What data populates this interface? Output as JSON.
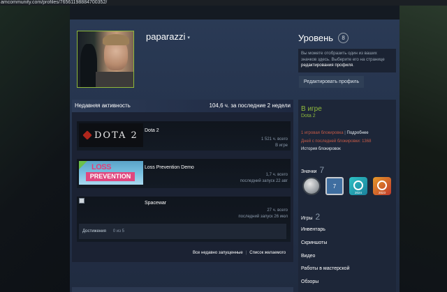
{
  "browser": {
    "url": "amcommunity.com/profiles/76561198884700352/"
  },
  "profile": {
    "persona_name": "paparazzi",
    "caret": "▾"
  },
  "level": {
    "title": "Уровень",
    "value": "8",
    "info_text_1": "Вы можете отобразить один из ваших значков здесь. Выберите его на странице ",
    "info_text_link": "редактирования профиля",
    "info_text_2": ".",
    "edit_button": "Редактировать профиль"
  },
  "activity": {
    "title": "Недавняя активность",
    "hours_summary": "104,6 ч. за последние 2 недели",
    "games": [
      {
        "name": "Dota 2",
        "capsule_text": "DOTA 2",
        "stat1": "1 521 ч. всего",
        "stat2": "В игре"
      },
      {
        "name": "Loss Prevention Demo",
        "capsule_line1": "LOSS",
        "capsule_line2": "PREVENTION",
        "stat1": "1,7 ч. всего",
        "stat2": "последний запуск 22 авг"
      },
      {
        "name": "Spacewar",
        "stat1": "27 ч. всего",
        "stat2": "последний запуск 26 июл",
        "achievements_label": "Достижения",
        "achievements_value": "0 из 5"
      }
    ],
    "link_recent": "Все недавно запущенные",
    "link_separator": "|",
    "link_wishlist": "Список желаемого"
  },
  "sidebar": {
    "status_title": "В игре",
    "status_game": "Dota 2",
    "ban_text": "1 игровая блокировка",
    "ban_separator": "|",
    "ban_more": "Подробнее",
    "ban_days": "Дней с последней блокировки: 1368",
    "ban_history": "История блокировок",
    "badges_label": "Значки",
    "badges_count": "7",
    "badge_items": [
      {
        "name": "silver-coin-badge-icon"
      },
      {
        "name": "years-of-service-badge-icon",
        "text": "7"
      },
      {
        "name": "steam-2024-badge-icon",
        "year": "2024"
      },
      {
        "name": "steam-2023-badge-icon",
        "year": "2023"
      }
    ],
    "games_label": "Игры",
    "games_count": "2",
    "links": [
      "Инвентарь",
      "Скриншоты",
      "Видео",
      "Работы в мастерской",
      "Обзоры"
    ]
  }
}
